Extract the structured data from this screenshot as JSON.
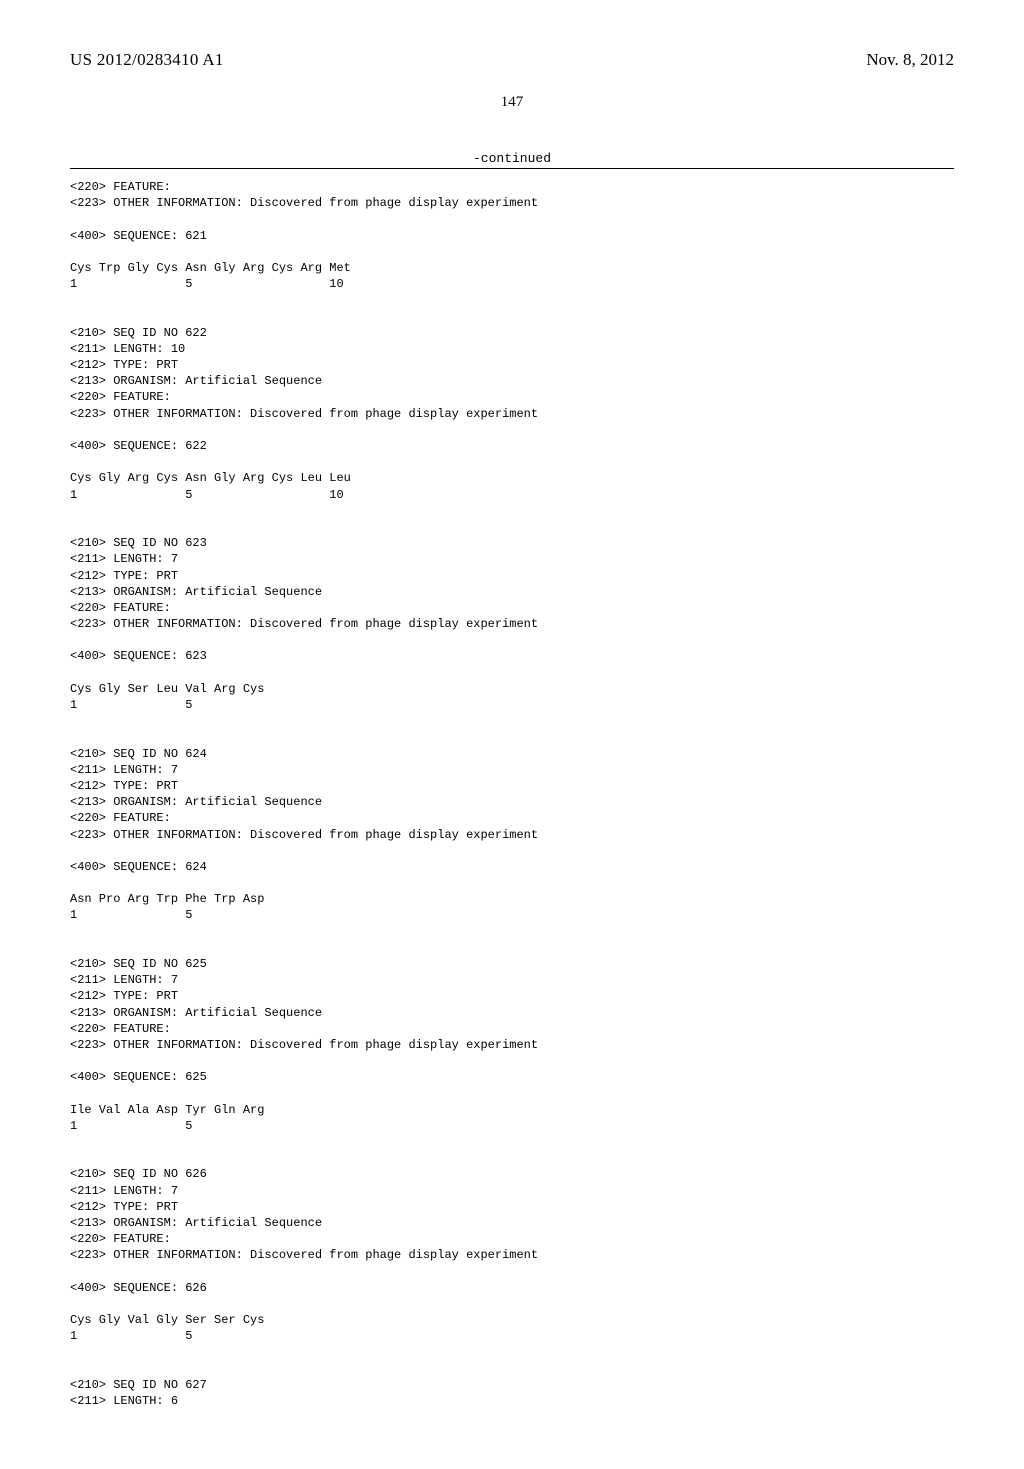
{
  "header": {
    "docId": "US 2012/0283410 A1",
    "date": "Nov. 8, 2012"
  },
  "pageNumber": "147",
  "continuedLabel": "-continued",
  "lines": [
    "<220> FEATURE:",
    "<223> OTHER INFORMATION: Discovered from phage display experiment",
    "",
    "<400> SEQUENCE: 621",
    "",
    "Cys Trp Gly Cys Asn Gly Arg Cys Arg Met",
    "1               5                   10",
    "",
    "",
    "<210> SEQ ID NO 622",
    "<211> LENGTH: 10",
    "<212> TYPE: PRT",
    "<213> ORGANISM: Artificial Sequence",
    "<220> FEATURE:",
    "<223> OTHER INFORMATION: Discovered from phage display experiment",
    "",
    "<400> SEQUENCE: 622",
    "",
    "Cys Gly Arg Cys Asn Gly Arg Cys Leu Leu",
    "1               5                   10",
    "",
    "",
    "<210> SEQ ID NO 623",
    "<211> LENGTH: 7",
    "<212> TYPE: PRT",
    "<213> ORGANISM: Artificial Sequence",
    "<220> FEATURE:",
    "<223> OTHER INFORMATION: Discovered from phage display experiment",
    "",
    "<400> SEQUENCE: 623",
    "",
    "Cys Gly Ser Leu Val Arg Cys",
    "1               5",
    "",
    "",
    "<210> SEQ ID NO 624",
    "<211> LENGTH: 7",
    "<212> TYPE: PRT",
    "<213> ORGANISM: Artificial Sequence",
    "<220> FEATURE:",
    "<223> OTHER INFORMATION: Discovered from phage display experiment",
    "",
    "<400> SEQUENCE: 624",
    "",
    "Asn Pro Arg Trp Phe Trp Asp",
    "1               5",
    "",
    "",
    "<210> SEQ ID NO 625",
    "<211> LENGTH: 7",
    "<212> TYPE: PRT",
    "<213> ORGANISM: Artificial Sequence",
    "<220> FEATURE:",
    "<223> OTHER INFORMATION: Discovered from phage display experiment",
    "",
    "<400> SEQUENCE: 625",
    "",
    "Ile Val Ala Asp Tyr Gln Arg",
    "1               5",
    "",
    "",
    "<210> SEQ ID NO 626",
    "<211> LENGTH: 7",
    "<212> TYPE: PRT",
    "<213> ORGANISM: Artificial Sequence",
    "<220> FEATURE:",
    "<223> OTHER INFORMATION: Discovered from phage display experiment",
    "",
    "<400> SEQUENCE: 626",
    "",
    "Cys Gly Val Gly Ser Ser Cys",
    "1               5",
    "",
    "",
    "<210> SEQ ID NO 627",
    "<211> LENGTH: 6"
  ]
}
